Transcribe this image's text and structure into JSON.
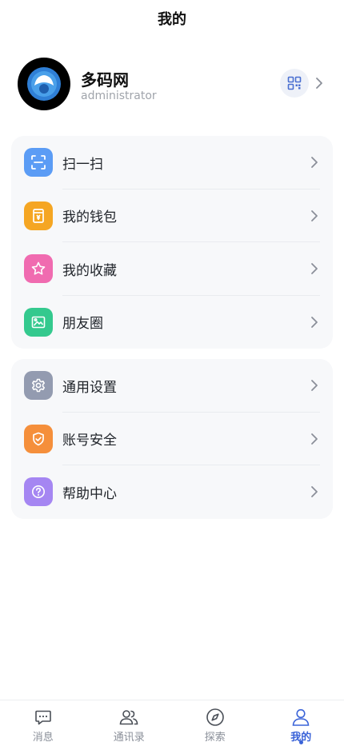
{
  "header": {
    "title": "我的"
  },
  "profile": {
    "name": "多码网",
    "role": "administrator"
  },
  "groups": [
    {
      "items": [
        {
          "label": "扫一扫",
          "icon": "scan-icon",
          "color": "#5b9cf5"
        },
        {
          "label": "我的钱包",
          "icon": "wallet-icon",
          "color": "#f5a623"
        },
        {
          "label": "我的收藏",
          "icon": "star-icon",
          "color": "#f06bb0"
        },
        {
          "label": "朋友圈",
          "icon": "image-icon",
          "color": "#34c98e"
        }
      ]
    },
    {
      "items": [
        {
          "label": "通用设置",
          "icon": "gear-icon",
          "color": "#939bb0"
        },
        {
          "label": "账号安全",
          "icon": "shield-icon",
          "color": "#f58f3b"
        },
        {
          "label": "帮助中心",
          "icon": "help-icon",
          "color": "#a586f2"
        }
      ]
    }
  ],
  "tabs": [
    {
      "label": "消息",
      "icon": "chat-icon",
      "active": false
    },
    {
      "label": "通讯录",
      "icon": "contacts-icon",
      "active": false
    },
    {
      "label": "探索",
      "icon": "compass-icon",
      "active": false
    },
    {
      "label": "我的",
      "icon": "user-icon",
      "active": true
    }
  ],
  "colors": {
    "accent": "#3a63d8",
    "card_background": "#f7f8fa"
  }
}
